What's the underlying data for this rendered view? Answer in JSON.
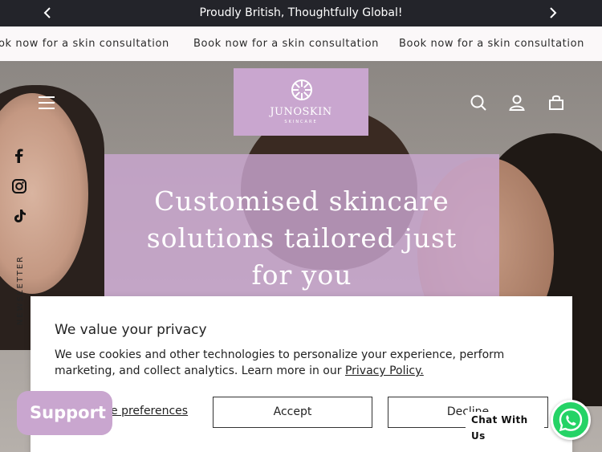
{
  "announcement": {
    "text": "Proudly British, Thoughtfully Global!"
  },
  "marquee": {
    "items": [
      "ok now for a skin consultation",
      "Book now for a skin consultation",
      "Book now for a skin consultation"
    ]
  },
  "header": {
    "logo": {
      "brand": "JUNOSKIN",
      "sub": "SKINCARE"
    }
  },
  "social": {
    "newsletter": "NEWSLETTER"
  },
  "hero": {
    "headline_lines": [
      "Customised skincare",
      "solutions tailored just",
      "for you"
    ]
  },
  "cookie": {
    "title": "We value your privacy",
    "body": "We use cookies and other technologies to personalize your experience, perform marketing, and collect analytics. Learn more in our",
    "policy_link": "Privacy Policy.",
    "preferences": "e preferences",
    "accept": "Accept",
    "decline": "Decline"
  },
  "widgets": {
    "support": "Support",
    "chat": "Chat With Us"
  },
  "colors": {
    "accent": "#c9a6cf",
    "dark": "#23242a",
    "whatsapp": "#25d366"
  }
}
